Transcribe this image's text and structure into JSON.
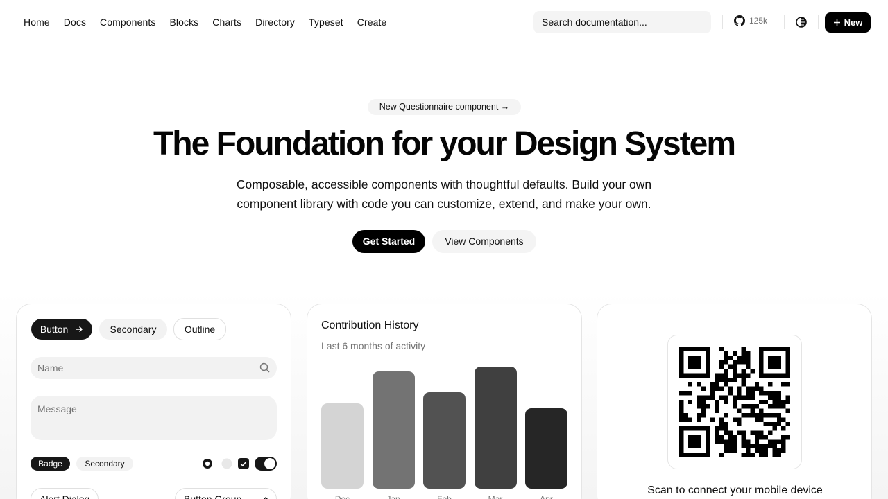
{
  "nav": {
    "links": [
      "Home",
      "Docs",
      "Components",
      "Blocks",
      "Charts",
      "Directory",
      "Typeset",
      "Create"
    ],
    "search_placeholder": "Search documentation...",
    "stars": "125k",
    "new_label": "New"
  },
  "hero": {
    "announcement": "New Questionnaire component →",
    "title": "The Foundation for your Design System",
    "description_line1": "Composable, accessible components with thoughtful defaults. Build your own",
    "description_line2": "component library with code you can customize, extend, and make your own.",
    "primary_cta": "Get Started",
    "secondary_cta": "View Components"
  },
  "components_card": {
    "button_label": "Button",
    "secondary_label": "Secondary",
    "outline_label": "Outline",
    "name_placeholder": "Name",
    "message_placeholder": "Message",
    "badge_label": "Badge",
    "badge_secondary_label": "Secondary",
    "alert_dialog_label": "Alert Dialog",
    "button_group_label": "Button Group"
  },
  "chart_card": {
    "title": "Contribution History",
    "subtitle": "Last 6 months of activity"
  },
  "chart_data": {
    "type": "bar",
    "categories": [
      "Dec",
      "Jan",
      "Feb",
      "Mar",
      "Apr"
    ],
    "values": [
      70,
      96,
      79,
      100,
      66
    ],
    "colors": [
      "#d4d4d4",
      "#737373",
      "#525252",
      "#404040",
      "#262626"
    ],
    "ylim": [
      0,
      100
    ]
  },
  "qr_card": {
    "caption": "Scan to connect your mobile device"
  }
}
